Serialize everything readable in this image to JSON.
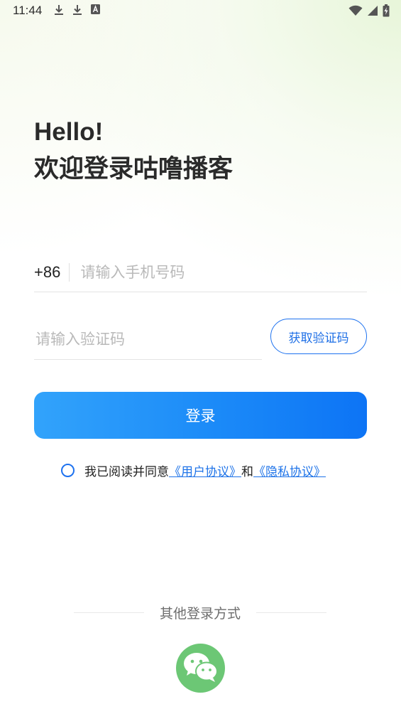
{
  "status_bar": {
    "time": "11:44",
    "icons": [
      "download-icon",
      "download-icon",
      "a-box-icon",
      "wifi-icon",
      "cellular-signal-icon",
      "battery-charging-icon"
    ]
  },
  "greeting": {
    "hello": "Hello!",
    "welcome": "欢迎登录咕噜播客"
  },
  "phone": {
    "country_code": "+86",
    "placeholder": "请输入手机号码",
    "value": ""
  },
  "code": {
    "placeholder": "请输入验证码",
    "value": "",
    "get_code_label": "获取验证码"
  },
  "login_button_label": "登录",
  "agreement": {
    "checked": false,
    "prefix": "我已阅读并同意",
    "user_agreement": "《用户协议》",
    "conjunction": "和",
    "privacy_agreement": "《隐私协议》"
  },
  "other_login": {
    "label": "其他登录方式",
    "options": [
      "wechat-icon"
    ]
  },
  "colors": {
    "accent": "#1e72ef",
    "login_gradient_start": "#32a3fb",
    "login_gradient_end": "#0d74f5",
    "wechat_green": "#6cc775"
  }
}
